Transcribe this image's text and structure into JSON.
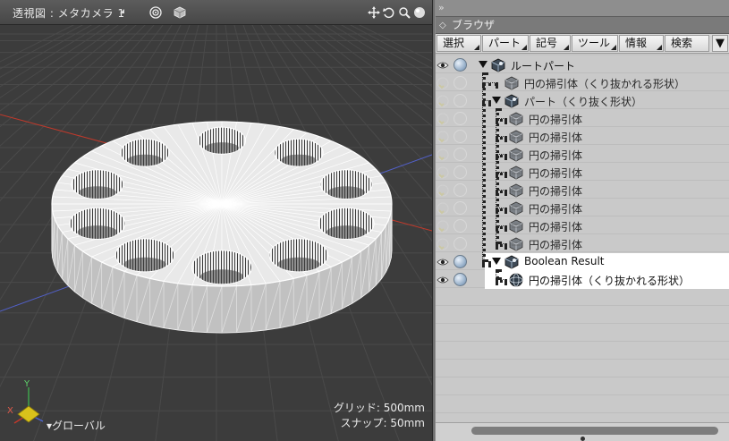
{
  "viewport": {
    "title": "透視図 : メタカメラ 1",
    "grid_label": "グリッド: 500mm",
    "snap_label": "スナップ: 50mm",
    "space_label": "▾グローバル",
    "axis_y": "Y",
    "axis_x": "X"
  },
  "browser": {
    "top_label": "»",
    "title": "ブラウザ",
    "toolbar": [
      "選択",
      "パート",
      "記号",
      "ツール",
      "情報",
      "検索"
    ],
    "menu_icon": "▼",
    "rows": [
      {
        "label": "ルートパート",
        "icon": "part-cube-icon",
        "depth": 0,
        "expanded": true,
        "visible": true,
        "selected": false
      },
      {
        "label": "円の掃引体（くり抜かれる形状）",
        "icon": "sweep-icon",
        "depth": 1,
        "expanded": false,
        "visible": false,
        "selected": false
      },
      {
        "label": "パート（くり抜く形状）",
        "icon": "part-cube-icon",
        "depth": 1,
        "expanded": true,
        "visible": false,
        "selected": false
      },
      {
        "label": "円の掃引体",
        "icon": "sweep-icon",
        "depth": 2,
        "visible": false,
        "selected": false
      },
      {
        "label": "円の掃引体",
        "icon": "sweep-icon",
        "depth": 2,
        "visible": false,
        "selected": false
      },
      {
        "label": "円の掃引体",
        "icon": "sweep-icon",
        "depth": 2,
        "visible": false,
        "selected": false
      },
      {
        "label": "円の掃引体",
        "icon": "sweep-icon",
        "depth": 2,
        "visible": false,
        "selected": false
      },
      {
        "label": "円の掃引体",
        "icon": "sweep-icon",
        "depth": 2,
        "visible": false,
        "selected": false
      },
      {
        "label": "円の掃引体",
        "icon": "sweep-icon",
        "depth": 2,
        "visible": false,
        "selected": false
      },
      {
        "label": "円の掃引体",
        "icon": "sweep-icon",
        "depth": 2,
        "visible": false,
        "selected": false
      },
      {
        "label": "円の掃引体",
        "icon": "sweep-icon",
        "depth": 2,
        "visible": false,
        "selected": false
      },
      {
        "label": "Boolean Result",
        "icon": "part-cube-icon",
        "depth": 1,
        "expanded": true,
        "visible": true,
        "selected": true
      },
      {
        "label": "円の掃引体（くり抜かれる形状）",
        "icon": "sphere-mesh-icon",
        "depth": 2,
        "visible": true,
        "selected": true
      }
    ]
  },
  "colors": {
    "viewport_bg": "#3c3c3c",
    "mesh_edge": "#ffffff",
    "browser_bg": "#c3c3c3",
    "axis_x_line": "#c0392b",
    "axis_y_line": "#5260c8"
  }
}
